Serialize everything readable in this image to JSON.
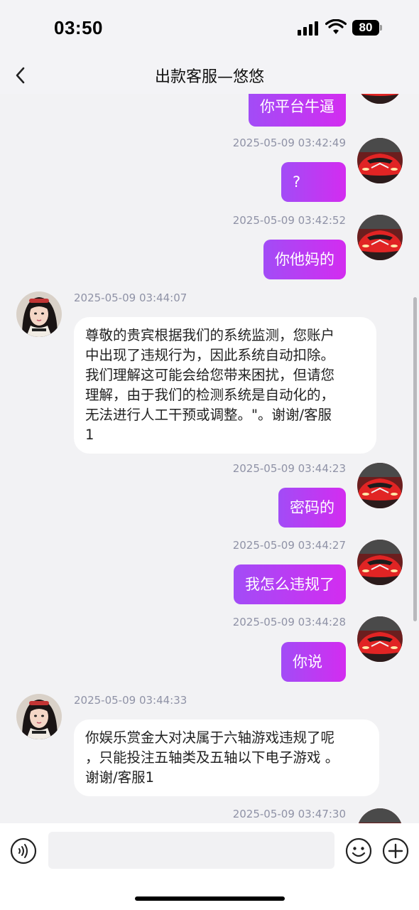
{
  "status_bar": {
    "time": "03:50",
    "battery": "80",
    "icons": [
      "cellular-signal-icon",
      "wifi-icon",
      "battery-icon"
    ]
  },
  "nav": {
    "title": "出款客服—悠悠",
    "back_icon": "chevron-left-icon"
  },
  "messages": [
    {
      "sender": "user",
      "text": "你平台牛逼"
    },
    {
      "sender": "user",
      "timestamp": "2025-05-09 03:42:49",
      "text": "?"
    },
    {
      "sender": "user",
      "timestamp": "2025-05-09 03:42:52",
      "text": "你他妈的"
    },
    {
      "sender": "agent",
      "timestamp": "2025-05-09 03:44:07",
      "lines": [
        "尊敬的贵宾根据我们的系统监测，您账户",
        "中出现了违规行为，因此系统自动扣除。",
        "我们理解这可能会给您带来困扰，但请您",
        "理解，由于我们的检测系统是自动化的，",
        "无法进行人工干预或调整。\"。谢谢/客服",
        "1"
      ]
    },
    {
      "sender": "user",
      "timestamp": "2025-05-09 03:44:23",
      "text": "密码的"
    },
    {
      "sender": "user",
      "timestamp": "2025-05-09 03:44:27",
      "text": "我怎么违规了"
    },
    {
      "sender": "user",
      "timestamp": "2025-05-09 03:44:28",
      "text": "你说"
    },
    {
      "sender": "agent",
      "timestamp": "2025-05-09 03:44:33",
      "lines": [
        "你娱乐赏金大对决属于六轴游戏违规了呢",
        "，只能投注五轴类及五轴以下电子游戏 。",
        "谢谢/客服1"
      ]
    },
    {
      "sender": "user",
      "timestamp": "2025-05-09 03:47:30",
      "text": ""
    }
  ],
  "input_bar": {
    "placeholder": "",
    "value": "",
    "icons": [
      "voice-icon",
      "emoji-icon",
      "plus-icon"
    ]
  },
  "colors": {
    "outgoing_bubble_start": "#a24cf6",
    "outgoing_bubble_end": "#d32cf0",
    "timestamp": "#8f92a6",
    "background": "#f2f2f4"
  }
}
